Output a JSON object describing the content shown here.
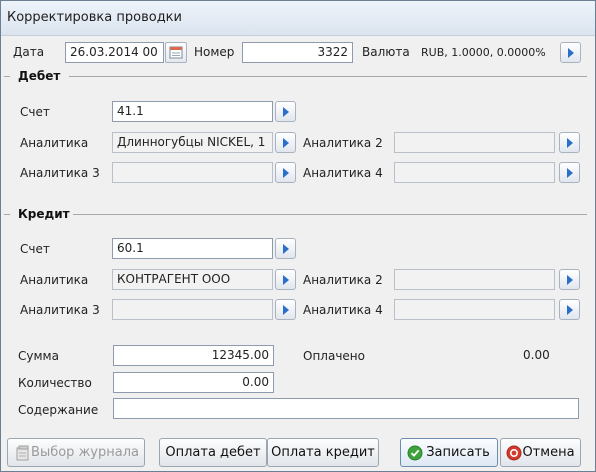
{
  "window": {
    "title": "Корректировка проводки"
  },
  "header": {
    "date_label": "Дата",
    "date_value": "26.03.2014 00",
    "number_label": "Номер",
    "number_value": "3322",
    "currency_label": "Валюта",
    "currency_value": "RUB, 1.0000, 0.0000%"
  },
  "debit": {
    "title": "Дебет",
    "account_label": "Счет",
    "account_value": "41.1",
    "analytics1_label": "Аналитика",
    "analytics1_value": "Длинногубцы NICKEL, 1",
    "analytics2_label": "Аналитика 2",
    "analytics2_value": "",
    "analytics3_label": "Аналитика 3",
    "analytics3_value": "",
    "analytics4_label": "Аналитика 4",
    "analytics4_value": ""
  },
  "credit": {
    "title": "Кредит",
    "account_label": "Счет",
    "account_value": "60.1",
    "analytics1_label": "Аналитика",
    "analytics1_value": "КОНТРАГЕНТ ООО",
    "analytics2_label": "Аналитика 2",
    "analytics2_value": "",
    "analytics3_label": "Аналитика 3",
    "analytics3_value": "",
    "analytics4_label": "Аналитика 4",
    "analytics4_value": ""
  },
  "totals": {
    "sum_label": "Сумма",
    "sum_value": "12345.00",
    "paid_label": "Оплачено",
    "paid_value": "0.00",
    "quantity_label": "Количество",
    "quantity_value": "0.00",
    "content_label": "Содержание",
    "content_value": ""
  },
  "buttons": {
    "journal": "Выбор журнала",
    "pay_debit": "Оплата дебет",
    "pay_credit": "Оплата кредит",
    "save": "Записать",
    "cancel": "Отмена"
  },
  "colors": {
    "accent": "#2a6fc9",
    "ok": "#3ea33e",
    "cancel": "#d33a2c"
  }
}
